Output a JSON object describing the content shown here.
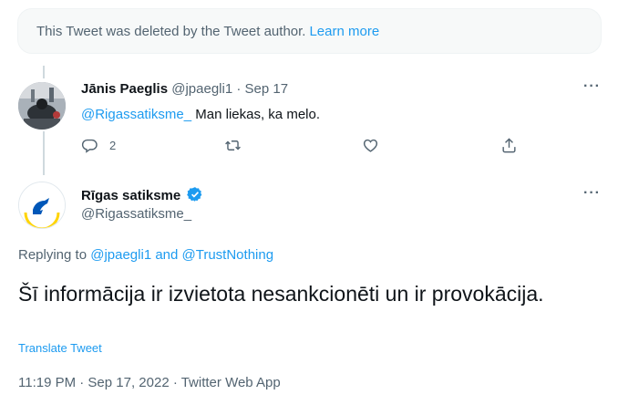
{
  "deleted_notice": {
    "text": "This Tweet was deleted by the Tweet author.",
    "link": "Learn more"
  },
  "reply": {
    "name": "Jānis Paeglis",
    "handle": "@jpaegli1",
    "separator": "·",
    "date": "Sep 17",
    "mention": "@Rigassatiksme_",
    "text": " Man liekas, ka melo.",
    "reply_count": "2",
    "icons": [
      "reply-icon",
      "retweet-icon",
      "like-icon",
      "share-icon"
    ]
  },
  "main_tweet": {
    "name": "Rīgas satiksme",
    "handle": "@Rigassatiksme_",
    "verified": true,
    "replying_prefix": "Replying to ",
    "replying_to": "@jpaegli1 and @TrustNothing",
    "text": "Šī informācija ir izvietota nesankcionēti un ir provokācija.",
    "translate": "Translate Tweet",
    "meta": "11:19 PM · Sep 17, 2022 · Twitter Web App"
  },
  "colors": {
    "accent": "#1d9bf0",
    "muted": "#536471",
    "brand_yellow": "#ffd400",
    "brand_blue": "#0057b8"
  }
}
